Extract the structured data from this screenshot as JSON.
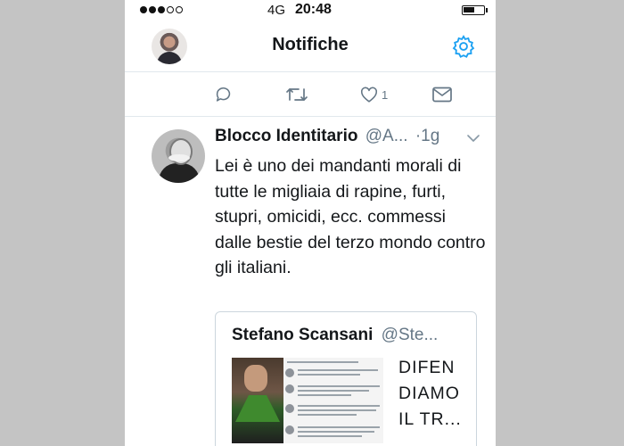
{
  "status_bar": {
    "carrier": "4G",
    "time": "20:48",
    "signal_bars_filled": 3,
    "signal_bars_total": 5
  },
  "header": {
    "title": "Notifiche",
    "settings_icon": "gear-icon"
  },
  "previous_tweet_actions": {
    "like_count": "1",
    "icons": [
      "reply-icon",
      "retweet-icon",
      "heart-icon",
      "mail-icon"
    ]
  },
  "tweet": {
    "author_name": "Blocco Identitario",
    "author_handle": "@A...",
    "time": "·1g",
    "text": "Lei è uno dei mandanti morali di tutte le migliaia di rapine, furti, stupri, omicidi, ecc. commessi dalle bestie del terzo mondo contro gli italiani.",
    "quoted": {
      "author_name": "Stefano Scansani",
      "author_handle": "@Ste...",
      "text": "DIFEN DIAMO IL TR..."
    }
  },
  "colors": {
    "accent": "#1da1f2",
    "icon_gray": "#657786",
    "text": "#14171a",
    "divider": "#e1e8ed",
    "page_background": "#c4c4c4"
  }
}
